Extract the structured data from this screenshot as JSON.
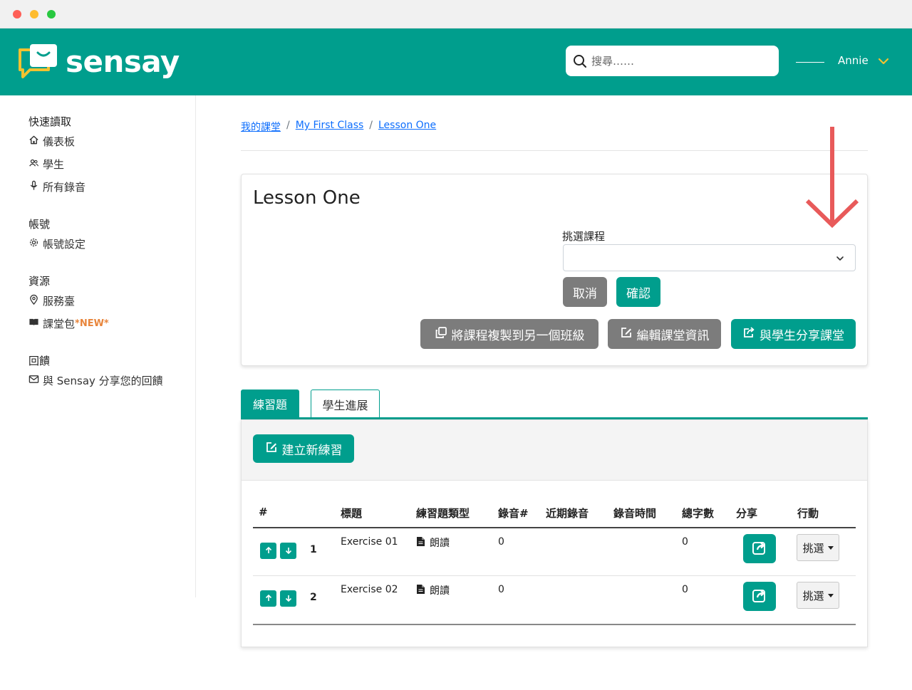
{
  "header": {
    "brand": "sensay",
    "search_placeholder": "搜尋……",
    "user_name": "Annie"
  },
  "sidebar": {
    "sections": [
      {
        "title": "快速讀取",
        "items": [
          {
            "label": "儀表板",
            "icon": "home-icon"
          },
          {
            "label": "學生",
            "icon": "users-icon"
          },
          {
            "label": "所有錄音",
            "icon": "microphone-icon"
          }
        ]
      },
      {
        "title": "帳號",
        "items": [
          {
            "label": "帳號設定",
            "icon": "gear-icon"
          }
        ]
      },
      {
        "title": "資源",
        "items": [
          {
            "label": "服務臺",
            "icon": "location-pin-icon"
          },
          {
            "label": "課堂包",
            "icon": "book-icon",
            "badge": "*NEW*"
          }
        ]
      },
      {
        "title": "回饋",
        "items": [
          {
            "label": "與 Sensay 分享您的回饋",
            "icon": "envelope-icon"
          }
        ]
      }
    ]
  },
  "breadcrumb": [
    "我的課堂",
    "My First Class",
    "Lesson One"
  ],
  "breadcrumb_separator": "/",
  "lesson": {
    "title": "Lesson One",
    "select_label": "挑選課程",
    "select_value": "",
    "cancel_label": "取消",
    "confirm_label": "確認",
    "copy_label": "將課程複製到另一個班級",
    "edit_label": "編輯課堂資訊",
    "share_label": "與學生分享課堂"
  },
  "tabs": [
    "練習題",
    "學生進展"
  ],
  "exercises": {
    "create_label": "建立新練習",
    "columns": [
      "#",
      "標題",
      "練習題類型",
      "錄音#",
      "近期錄音",
      "錄音時間",
      "總字數",
      "分享",
      "行動"
    ],
    "rows": [
      {
        "num": "1",
        "title": "Exercise 01",
        "type": "朗讀",
        "recordings": "0",
        "recent": "",
        "time": "",
        "words": "0",
        "action": "挑選"
      },
      {
        "num": "2",
        "title": "Exercise 02",
        "type": "朗讀",
        "recordings": "0",
        "recent": "",
        "time": "",
        "words": "0",
        "action": "挑選"
      }
    ]
  },
  "colors": {
    "brand": "#009e8d",
    "grey_button": "#7c7c7c",
    "accent_new": "#e8853b",
    "annotation_arrow": "#e85a5a"
  }
}
